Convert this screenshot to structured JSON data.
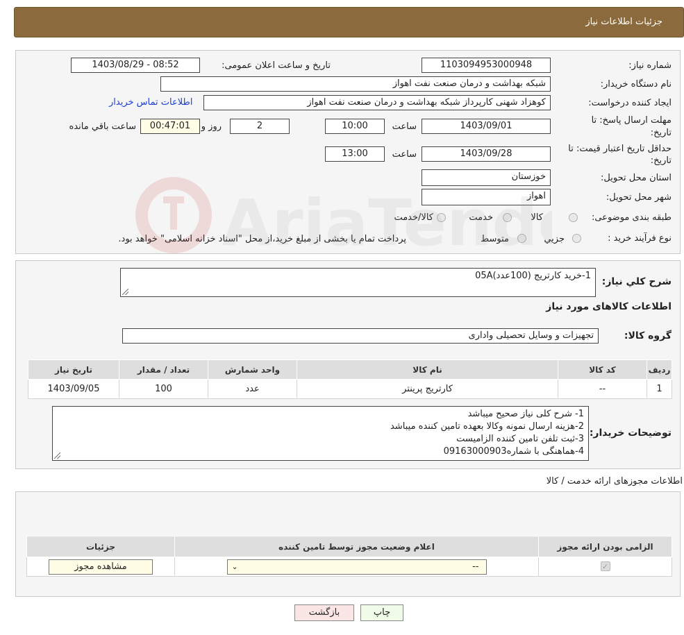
{
  "header": {
    "title": "جزئیات اطلاعات نیاز"
  },
  "need_info": {
    "need_number_label": "شماره نیاز:",
    "need_number": "1103094953000948",
    "announce_label": "تاریخ و ساعت اعلان عمومی:",
    "announce_value": "1403/08/29 - 08:52",
    "buyer_org_label": "نام دستگاه خریدار:",
    "buyer_org": "شبکه بهداشت و درمان صنعت نفت اهواز",
    "creator_label": "ایجاد کننده درخواست:",
    "creator": "کوهزاد شهنی کارپرداز شبکه بهداشت و درمان صنعت نفت اهواز",
    "contact_link": "اطلاعات تماس خریدار",
    "deadline_label_1": "مهلت ارسال پاسخ: تا",
    "deadline_label_2": "تاریخ:",
    "deadline_date": "1403/09/01",
    "time_label": "ساعت",
    "deadline_time": "10:00",
    "days_value": "2",
    "days_label": "روز و",
    "remaining_time": "00:47:01",
    "remaining_label": "ساعت باقي مانده",
    "validity_label_1": "حداقل تاریخ اعتبار قیمت: تا",
    "validity_label_2": "تاریخ:",
    "validity_date": "1403/09/28",
    "validity_time": "13:00",
    "province_label": "استان محل تحویل:",
    "province": "خوزستان",
    "city_label": "شهر محل تحویل:",
    "city": "اهواز",
    "category_label": "طبقه بندی موضوعی:",
    "category_options": [
      "کالا",
      "خدمت",
      "کالا/خدمت"
    ],
    "purchase_type_label": "نوع فرآیند خرید :",
    "purchase_options": [
      "جزیي",
      "متوسط"
    ],
    "purchase_note": "پرداخت تمام یا بخشی از مبلغ خرید،از محل \"اسناد خزانه اسلامی\" خواهد بود."
  },
  "summary": {
    "label": "شرح کلي نیاز:",
    "text": "1-خرید کارتریج  (100عدد)05A",
    "goods_info_title": "اطلاعات کالاهای مورد نیاز",
    "goods_group_label": "گروه کالا:",
    "goods_group": "تجهیزات و وسایل تحصیلی واداری",
    "table_headers": [
      "ردیف",
      "کد کالا",
      "نام کالا",
      "واحد شمارش",
      "تعداد / مقدار",
      "تاریخ نیاز"
    ],
    "rows": [
      [
        "1",
        "--",
        "کارتریج پرینتر",
        "عدد",
        "100",
        "1403/09/05"
      ]
    ],
    "buyer_notes_label": "توضیحات خریدار:",
    "buyer_notes": [
      "1- شرح کلی نیاز صحیح میباشد",
      "2-هزینه ارسال نمونه وکالا بعهده تامین کننده میباشد",
      "3-ثبت تلفن تامین کننده الزامیست",
      "4-هماهنگی با شماره09163000903"
    ]
  },
  "permits": {
    "title": "اطلاعات مجوزهای ارائه خدمت / کالا",
    "table_headers": [
      "الزامی بودن ارائه مجوز",
      "اعلام وضعیت مجوز توسط تامین کننده",
      "جزئیات"
    ],
    "select_value": "--",
    "view_button": "مشاهده مجوز"
  },
  "actions": {
    "print": "چاپ",
    "back": "بازگشت"
  },
  "watermark": "AriaTender.neT"
}
